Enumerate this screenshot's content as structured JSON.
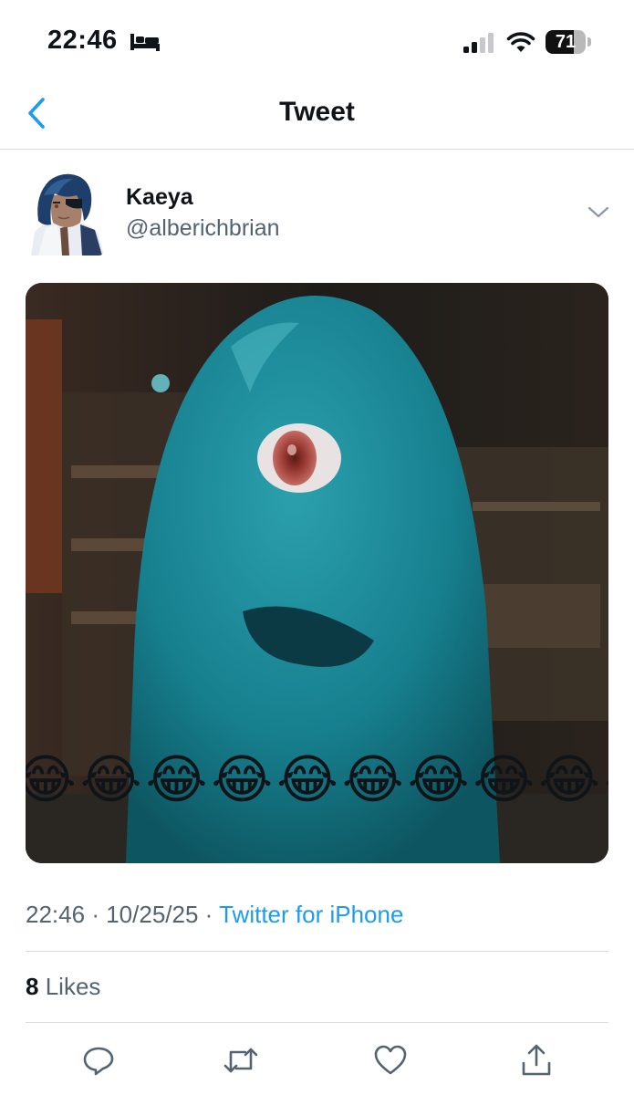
{
  "status_bar": {
    "time": "22:46",
    "focus_icon": "bed-icon",
    "signal_icon": "cellular-signal-icon",
    "wifi_icon": "wifi-icon",
    "battery_percent": "71",
    "battery_level": 0.71
  },
  "nav": {
    "back_icon": "chevron-left-icon",
    "title": "Tweet"
  },
  "author": {
    "display_name": "Kaeya",
    "handle": "@alberichbrian",
    "more_icon": "chevron-down-icon"
  },
  "media": {
    "description_icon": "laughing-crying-emoji",
    "emoji": "😂"
  },
  "meta": {
    "time": "22:46",
    "separator": "·",
    "date": "10/25/25",
    "source": "Twitter for iPhone"
  },
  "stats": {
    "likes_count": "8",
    "likes_label": "Likes"
  },
  "actions": {
    "reply_icon": "reply-icon",
    "retweet_icon": "retweet-icon",
    "like_icon": "heart-icon",
    "share_icon": "share-icon"
  },
  "colors": {
    "accent": "#1d9bf0",
    "secondary_text": "#536471",
    "primary_text": "#0f1419",
    "divider": "#d9dde1"
  }
}
